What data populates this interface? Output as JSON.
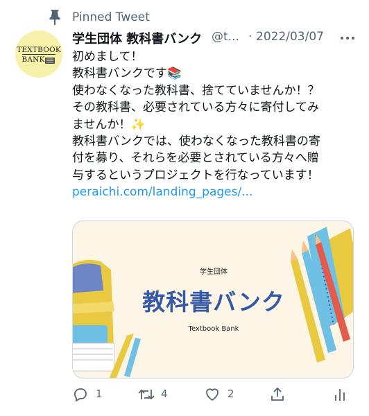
{
  "pinned": {
    "label": "Pinned Tweet",
    "icon": "pin-icon"
  },
  "avatar": {
    "line1": "TEXTBOOK",
    "line2": "BANK"
  },
  "author": {
    "name": "学生団体 教科書バンク",
    "handle": "@t...",
    "separator": "·",
    "date": "2022/03/07"
  },
  "tweet": {
    "lines": [
      "初めまして！",
      "教科書バンクです📚",
      "使わなくなった教科書、捨てていませんか！？",
      "その教科書、必要されている方々に寄付してみ",
      "ませんか！✨",
      "教科書バンクでは、使わなくなった教科書の寄",
      "付を募り、それらを必要とされている方々へ贈",
      "与するというプロジェクトを行なっています！"
    ],
    "link": "peraichi.com/landing_pages/..."
  },
  "card": {
    "subtitle": "学生団体",
    "title": "教科書バンク",
    "subtitle_en": "Textbook Bank"
  },
  "actions": {
    "reply": {
      "icon": "reply-icon",
      "count": "1"
    },
    "retweet": {
      "icon": "retweet-icon",
      "count": "4"
    },
    "like": {
      "icon": "heart-icon",
      "count": "2"
    },
    "share": {
      "icon": "share-icon"
    },
    "analytics": {
      "icon": "analytics-icon"
    }
  },
  "colors": {
    "accent": "#1d9bf0",
    "secondary_text": "#536471",
    "card_title": "#3559a8",
    "card_background": "#fdf5e6"
  }
}
